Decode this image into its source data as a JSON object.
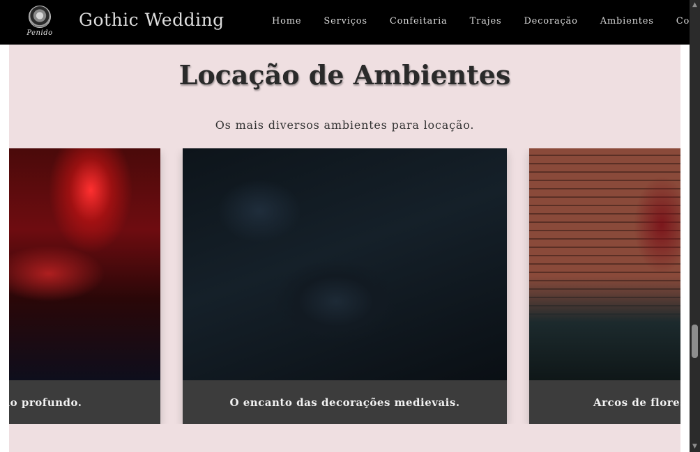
{
  "brand": {
    "logo_text": "Penido",
    "name": "Gothic Wedding"
  },
  "nav": {
    "items": [
      {
        "label": "Home"
      },
      {
        "label": "Serviços"
      },
      {
        "label": "Confeitaria"
      },
      {
        "label": "Trajes"
      },
      {
        "label": "Decoração"
      },
      {
        "label": "Ambientes"
      },
      {
        "label": "Contato"
      }
    ]
  },
  "section": {
    "title": "Locação de Ambientes",
    "subtitle": "Os mais diversos ambientes para locação."
  },
  "carousel": {
    "cards": [
      {
        "caption": "elho profundo.",
        "image": "red-ballroom-table-image"
      },
      {
        "caption": "O encanto das decorações medievais.",
        "image": "dark-blue-table-setting-image"
      },
      {
        "caption": "Arcos de flores",
        "image": "brick-wall-flower-arch-image"
      }
    ]
  },
  "colors": {
    "navbar_bg": "#000000",
    "section_bg": "#efdfe1",
    "caption_bg": "#3c3c3c",
    "scrollbar_bg": "#2b2b2b"
  },
  "icons": {
    "logo": "penido-emblem-icon",
    "scroll_up": "chevron-up-icon",
    "scroll_down": "chevron-down-icon"
  }
}
